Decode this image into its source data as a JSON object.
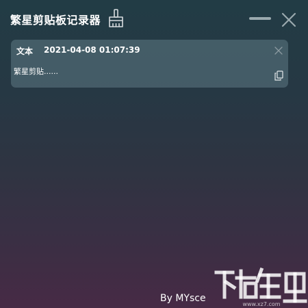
{
  "window": {
    "title": "繁星剪贴板记录器"
  },
  "toolbar": {
    "clear_icon": "broom-icon",
    "minimize_icon": "minimize-icon",
    "close_icon": "close-icon"
  },
  "clips": [
    {
      "type": "文本",
      "timestamp": "2021-04-08 01:07:39",
      "content": "繁星剪贴......",
      "delete_icon": "close-icon",
      "copy_icon": "copy-icon"
    }
  ],
  "footer": {
    "author": "By MYsce"
  },
  "colors": {
    "background_top": "#223c45",
    "background_bottom": "#472a45",
    "card": "#52717c",
    "text": "#ffffff",
    "icon_muted": "#9aa9ae"
  }
}
